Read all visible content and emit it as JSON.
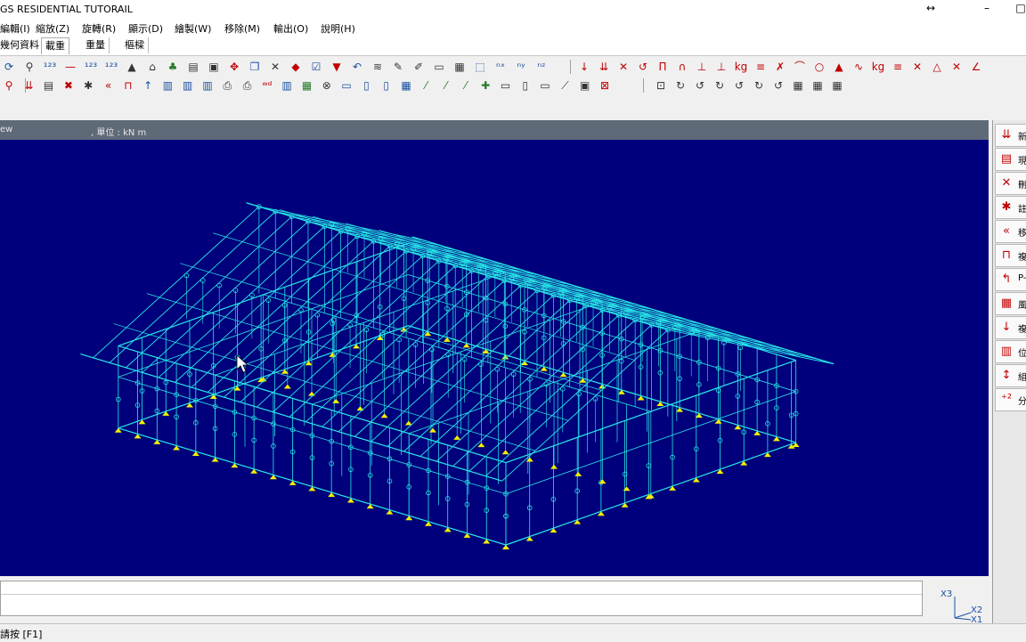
{
  "window": {
    "title": "GS RESIDENTIAL TUTORAIL",
    "controls": {
      "resize": "↔",
      "minimize": "–",
      "maximize": "□"
    }
  },
  "menu": [
    "編輯(I)",
    "縮放(Z)",
    "旋轉(R)",
    "顯示(D)",
    "繪製(W)",
    "移除(M)",
    "輸出(O)",
    "說明(H)"
  ],
  "tabs": [
    "幾何資料",
    "載重",
    "重量",
    "樞樑"
  ],
  "active_tab": "載重",
  "toolbar1_icons": [
    "rotate-icon",
    "zoom-icon",
    "node-number-icon",
    "member-number-icon",
    "element-number-icon",
    "plate-number-icon",
    "support-icon",
    "load-icon",
    "tree-icon",
    "section-icon",
    "property-icon",
    "move-icon",
    "copy-icon",
    "delete-icon",
    "cube-icon",
    "checklist-icon",
    "arrow-down-icon",
    "undo-icon",
    "layers-icon",
    "paint-icon",
    "brush-icon",
    "frame-icon",
    "grid-icon",
    "zoom-window-icon",
    "number-x-icon",
    "number-y-icon",
    "number-z-icon"
  ],
  "toolbar1_right_icons": [
    "point-load-icon",
    "uniform-load-icon",
    "cross-icon",
    "moment-icon",
    "frame-load-icon",
    "arch-load-icon",
    "support-load-icon",
    "mass-icon",
    "weight-icon",
    "beam-load-icon",
    "remove-load-icon",
    "hinge-icon",
    "roller-icon",
    "fixed-icon",
    "spring-icon",
    "kg-icon",
    "distributed-icon",
    "cancel-icon",
    "triangle-icon",
    "delete-triangle-icon",
    "angle-icon"
  ],
  "toolbar2_icons": [
    "filter-icon",
    "load-down-icon",
    "load-list-icon",
    "delete-red-icon",
    "star-icon",
    "move-left-icon",
    "member-icon",
    "column-icon",
    "grid-pattern-icon",
    "grid-pattern2-icon",
    "grid-pattern3-icon",
    "printer-icon",
    "printer2-icon",
    "load-case-icon",
    "table-icon",
    "building-icon",
    "close-circle-icon",
    "window-icon",
    "window2-icon",
    "window3-icon",
    "grid4-icon",
    "draw-line-icon",
    "draw-line2-icon",
    "draw-line3-icon",
    "node-add-icon",
    "rect1-icon",
    "rect2-icon",
    "rect3-icon",
    "rect4-icon",
    "rect5-icon",
    "close-box-icon"
  ],
  "toolbar2_right_icons": [
    "select-box-icon",
    "rot-x-plus-icon",
    "rot-x-minus-icon",
    "rot-y-plus-icon",
    "rot-y-minus-icon",
    "rot-z-plus-icon",
    "rot-z-minus-icon",
    "view-xy-icon",
    "view-xz-icon",
    "view-yz-icon"
  ],
  "viewport": {
    "name_fragment": "ew",
    "units": ", 單位 : kN m",
    "background": "#00007c",
    "model_color": "#28e8e8",
    "support_color": "#f0f000"
  },
  "right_panel": [
    {
      "icon": "new-load-icon",
      "label": "新"
    },
    {
      "icon": "current-load-icon",
      "label": "現"
    },
    {
      "icon": "delete-icon",
      "label": "刪"
    },
    {
      "icon": "note-icon",
      "label": "註"
    },
    {
      "icon": "move-icon",
      "label": "移"
    },
    {
      "icon": "copy-icon",
      "label": "複"
    },
    {
      "icon": "p-delta-icon",
      "label": "P-"
    },
    {
      "icon": "wind-icon",
      "label": "風"
    },
    {
      "icon": "combine-icon",
      "label": "複"
    },
    {
      "icon": "position-icon",
      "label": "位"
    },
    {
      "icon": "group-icon",
      "label": "組"
    },
    {
      "icon": "distribute-icon",
      "label": "分"
    }
  ],
  "axis": {
    "x3": "X3",
    "x2": "X2",
    "x1": "X1"
  },
  "status": "請按 [F1]"
}
